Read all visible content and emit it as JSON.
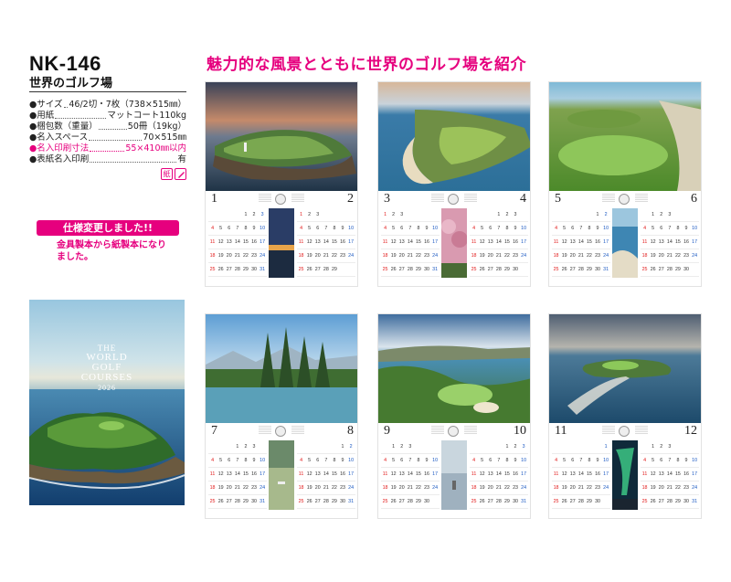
{
  "product": {
    "code": "NK-146",
    "name": "世界のゴルフ場"
  },
  "specs": [
    {
      "key": "●サイズ",
      "value": "46/2切・7枚（738×515㎜）",
      "highlight": false
    },
    {
      "key": "●用紙",
      "value": "マットコート110kg",
      "highlight": false
    },
    {
      "key": "●梱包数（重量）",
      "value": "50冊（19kg）",
      "highlight": false
    },
    {
      "key": "●名入スペース",
      "value": "70×515㎜",
      "highlight": false
    },
    {
      "key": "●名入印刷寸法",
      "value": "55×410㎜以内",
      "highlight": true
    },
    {
      "key": "●表紙名入印刷",
      "value": "有",
      "highlight": false
    }
  ],
  "badges": [
    "紙",
    "ペン"
  ],
  "spec_change": {
    "banner": "仕様変更しました!!",
    "note": "金具製本から紙製本になりました。"
  },
  "headline": "魅力的な風景とともに世界のゴルフ場を紹介",
  "cover": {
    "line1": "THE",
    "line2": "WORLD",
    "line3": "GOLF",
    "line4": "COURSES",
    "year": "2026"
  },
  "sheets": [
    {
      "left_month": "1",
      "right_month": "2"
    },
    {
      "left_month": "3",
      "right_month": "4"
    },
    {
      "left_month": "5",
      "right_month": "6"
    },
    {
      "left_month": "7",
      "right_month": "8"
    },
    {
      "left_month": "9",
      "right_month": "10"
    },
    {
      "left_month": "11",
      "right_month": "12"
    }
  ],
  "calendar_rows": [
    [
      "1",
      "2",
      "3"
    ],
    [
      "4",
      "5",
      "6",
      "7",
      "8",
      "9",
      "10"
    ],
    [
      "11",
      "12",
      "13",
      "14",
      "15",
      "16",
      "17"
    ],
    [
      "18",
      "19",
      "20",
      "21",
      "22",
      "23",
      "24"
    ],
    [
      "25",
      "26",
      "27",
      "28",
      "29",
      "30",
      "31"
    ]
  ]
}
